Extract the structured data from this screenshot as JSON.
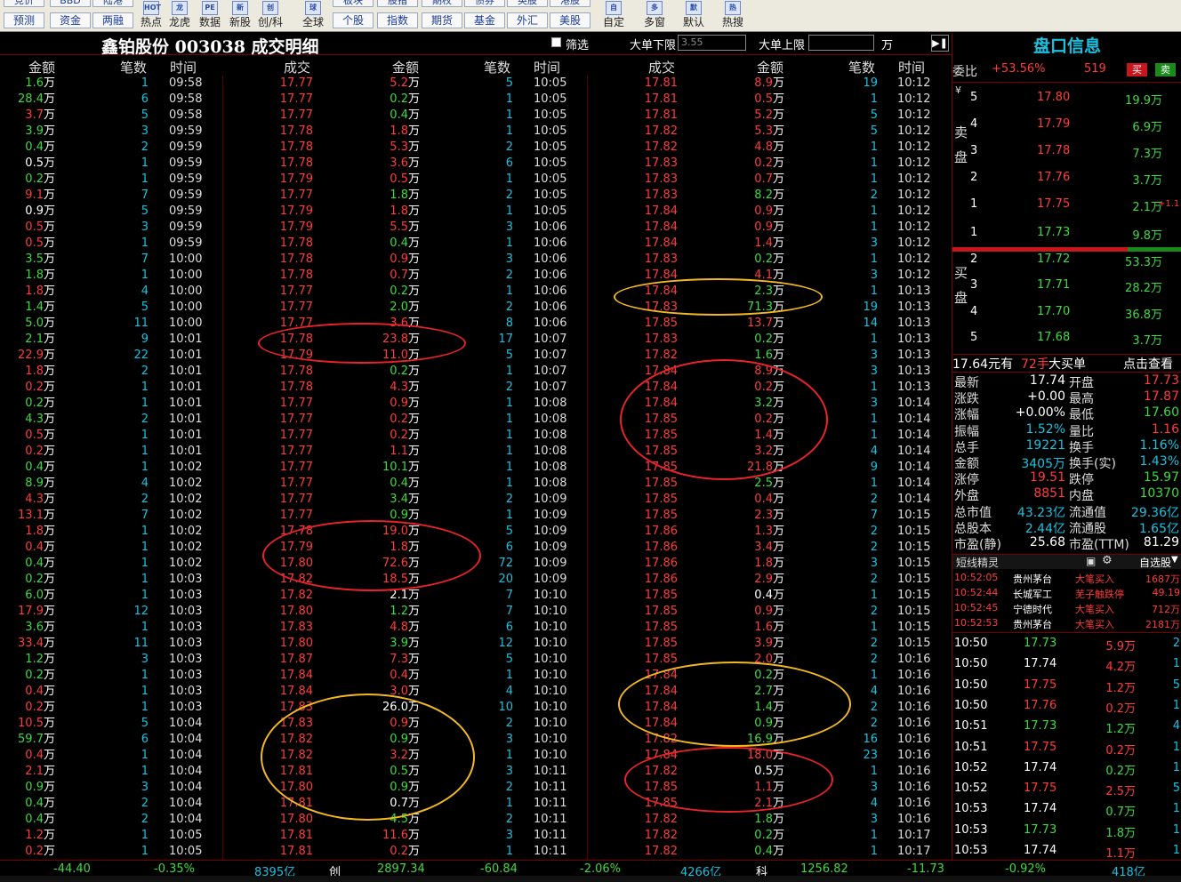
{
  "toolbar": {
    "pairs": [
      {
        "top": "竞价",
        "bottom": "预测"
      },
      {
        "top": "BBD",
        "bottom": "资金"
      },
      {
        "top": "陆港",
        "bottom": "两融"
      }
    ],
    "big": [
      {
        "icon": "HOT",
        "label": "热点"
      },
      {
        "icon": "龙",
        "label": "龙虎"
      },
      {
        "icon": "PE",
        "label": "数据"
      },
      {
        "icon": "新",
        "label": "新股"
      },
      {
        "icon": "创",
        "label": "创/科"
      },
      {
        "icon": "球",
        "label": "全球"
      }
    ],
    "pairs2": [
      {
        "top": "板块",
        "bottom": "个股"
      },
      {
        "top": "股指",
        "bottom": "指数"
      },
      {
        "top": "期权",
        "bottom": "期货"
      },
      {
        "top": "债券",
        "bottom": "基金"
      },
      {
        "top": "英股",
        "bottom": "外汇"
      },
      {
        "top": "港股",
        "bottom": "美股"
      }
    ],
    "right": [
      {
        "icon": "自",
        "label": "自定"
      },
      {
        "icon": "多",
        "label": "多窗"
      },
      {
        "icon": "默",
        "label": "默认"
      },
      {
        "icon": "热",
        "label": "热搜"
      }
    ]
  },
  "header": {
    "title": "鑫铂股份 003038 成交明细",
    "filter_label": "筛选",
    "lower_label": "大单下限",
    "lower_value": "3.55",
    "upper_label": "大单上限",
    "upper_value": "",
    "unit": "万"
  },
  "columns": {
    "g1": [
      "金额",
      "笔数",
      "时间"
    ],
    "g2": [
      "成交",
      "金额",
      "笔数",
      "时间"
    ],
    "g3": [
      "成交",
      "金额",
      "笔数",
      "时间"
    ]
  },
  "colors": {
    "red": "#ff3b3b",
    "green": "#3cdc3c",
    "cyan": "#19c1e0",
    "white": "#ffffff",
    "ellipse_red": "#e8232a",
    "ellipse_orange": "#f3b823"
  },
  "rows1": [
    [
      "1.6",
      "g",
      "1",
      "09:58"
    ],
    [
      "28.4",
      "g",
      "6",
      "09:58"
    ],
    [
      "3.7",
      "r",
      "5",
      "09:58"
    ],
    [
      "3.9",
      "g",
      "3",
      "09:59"
    ],
    [
      "0.4",
      "g",
      "2",
      "09:59"
    ],
    [
      "0.5",
      "w",
      "1",
      "09:59"
    ],
    [
      "0.2",
      "g",
      "1",
      "09:59"
    ],
    [
      "9.1",
      "r",
      "7",
      "09:59"
    ],
    [
      "0.9",
      "w",
      "5",
      "09:59"
    ],
    [
      "0.5",
      "r",
      "3",
      "09:59"
    ],
    [
      "0.5",
      "r",
      "1",
      "09:59"
    ],
    [
      "3.5",
      "g",
      "7",
      "10:00"
    ],
    [
      "1.8",
      "g",
      "1",
      "10:00"
    ],
    [
      "1.8",
      "r",
      "4",
      "10:00"
    ],
    [
      "1.4",
      "g",
      "5",
      "10:00"
    ],
    [
      "5.0",
      "g",
      "11",
      "10:00"
    ],
    [
      "2.1",
      "g",
      "9",
      "10:01"
    ],
    [
      "22.9",
      "r",
      "22",
      "10:01"
    ],
    [
      "1.8",
      "r",
      "2",
      "10:01"
    ],
    [
      "0.2",
      "r",
      "1",
      "10:01"
    ],
    [
      "0.2",
      "g",
      "1",
      "10:01"
    ],
    [
      "4.3",
      "g",
      "2",
      "10:01"
    ],
    [
      "0.5",
      "r",
      "1",
      "10:01"
    ],
    [
      "0.2",
      "r",
      "1",
      "10:01"
    ],
    [
      "0.4",
      "g",
      "1",
      "10:02"
    ],
    [
      "8.9",
      "g",
      "4",
      "10:02"
    ],
    [
      "4.3",
      "r",
      "2",
      "10:02"
    ],
    [
      "13.1",
      "r",
      "7",
      "10:02"
    ],
    [
      "1.8",
      "r",
      "1",
      "10:02"
    ],
    [
      "0.4",
      "r",
      "1",
      "10:02"
    ],
    [
      "0.4",
      "g",
      "1",
      "10:02"
    ],
    [
      "0.2",
      "g",
      "1",
      "10:03"
    ],
    [
      "6.0",
      "g",
      "1",
      "10:03"
    ],
    [
      "17.9",
      "r",
      "12",
      "10:03"
    ],
    [
      "3.6",
      "g",
      "1",
      "10:03"
    ],
    [
      "33.4",
      "r",
      "11",
      "10:03"
    ],
    [
      "1.2",
      "g",
      "3",
      "10:03"
    ],
    [
      "0.2",
      "g",
      "1",
      "10:03"
    ],
    [
      "0.4",
      "r",
      "1",
      "10:03"
    ],
    [
      "0.2",
      "r",
      "1",
      "10:03"
    ],
    [
      "10.5",
      "r",
      "5",
      "10:04"
    ],
    [
      "59.7",
      "g",
      "6",
      "10:04"
    ],
    [
      "0.4",
      "r",
      "1",
      "10:04"
    ],
    [
      "2.1",
      "r",
      "1",
      "10:04"
    ],
    [
      "0.9",
      "g",
      "3",
      "10:04"
    ],
    [
      "0.4",
      "g",
      "2",
      "10:04"
    ],
    [
      "0.4",
      "g",
      "2",
      "10:04"
    ],
    [
      "1.2",
      "r",
      "1",
      "10:05"
    ],
    [
      "0.2",
      "r",
      "1",
      "10:05"
    ]
  ],
  "rows2": [
    [
      "17.77",
      "5.2",
      "r",
      "5",
      "10:05"
    ],
    [
      "17.77",
      "0.2",
      "g",
      "1",
      "10:05"
    ],
    [
      "17.77",
      "0.4",
      "g",
      "1",
      "10:05"
    ],
    [
      "17.78",
      "1.8",
      "r",
      "1",
      "10:05"
    ],
    [
      "17.78",
      "5.3",
      "r",
      "2",
      "10:05"
    ],
    [
      "17.78",
      "3.6",
      "r",
      "6",
      "10:05"
    ],
    [
      "17.79",
      "0.5",
      "r",
      "1",
      "10:05"
    ],
    [
      "17.77",
      "1.8",
      "g",
      "2",
      "10:05"
    ],
    [
      "17.79",
      "1.8",
      "r",
      "1",
      "10:05"
    ],
    [
      "17.79",
      "5.5",
      "r",
      "3",
      "10:06"
    ],
    [
      "17.78",
      "0.4",
      "g",
      "1",
      "10:06"
    ],
    [
      "17.78",
      "0.9",
      "r",
      "3",
      "10:06"
    ],
    [
      "17.78",
      "0.7",
      "r",
      "2",
      "10:06"
    ],
    [
      "17.77",
      "0.2",
      "g",
      "1",
      "10:06"
    ],
    [
      "17.77",
      "2.0",
      "g",
      "2",
      "10:06"
    ],
    [
      "17.77",
      "3.6",
      "r",
      "8",
      "10:06"
    ],
    [
      "17.78",
      "23.8",
      "r",
      "17",
      "10:07"
    ],
    [
      "17.79",
      "11.0",
      "r",
      "5",
      "10:07"
    ],
    [
      "17.78",
      "0.2",
      "g",
      "1",
      "10:07"
    ],
    [
      "17.78",
      "4.3",
      "r",
      "2",
      "10:07"
    ],
    [
      "17.77",
      "0.9",
      "r",
      "1",
      "10:08"
    ],
    [
      "17.77",
      "0.2",
      "r",
      "1",
      "10:08"
    ],
    [
      "17.77",
      "0.2",
      "r",
      "1",
      "10:08"
    ],
    [
      "17.77",
      "1.1",
      "r",
      "1",
      "10:08"
    ],
    [
      "17.77",
      "10.1",
      "g",
      "1",
      "10:08"
    ],
    [
      "17.77",
      "0.4",
      "g",
      "1",
      "10:08"
    ],
    [
      "17.77",
      "3.4",
      "g",
      "2",
      "10:09"
    ],
    [
      "17.77",
      "0.9",
      "g",
      "1",
      "10:09"
    ],
    [
      "17.78",
      "19.0",
      "r",
      "5",
      "10:09"
    ],
    [
      "17.79",
      "1.8",
      "r",
      "6",
      "10:09"
    ],
    [
      "17.80",
      "72.6",
      "r",
      "72",
      "10:09"
    ],
    [
      "17.82",
      "18.5",
      "r",
      "20",
      "10:09"
    ],
    [
      "17.82",
      "2.1",
      "w",
      "7",
      "10:10"
    ],
    [
      "17.80",
      "1.2",
      "g",
      "7",
      "10:10"
    ],
    [
      "17.83",
      "4.8",
      "r",
      "6",
      "10:10"
    ],
    [
      "17.80",
      "3.9",
      "g",
      "12",
      "10:10"
    ],
    [
      "17.87",
      "7.3",
      "r",
      "5",
      "10:10"
    ],
    [
      "17.84",
      "0.4",
      "r",
      "1",
      "10:10"
    ],
    [
      "17.84",
      "3.0",
      "r",
      "4",
      "10:10"
    ],
    [
      "17.83",
      "26.0",
      "w",
      "10",
      "10:10"
    ],
    [
      "17.83",
      "0.9",
      "r",
      "2",
      "10:10"
    ],
    [
      "17.82",
      "0.9",
      "g",
      "3",
      "10:10"
    ],
    [
      "17.82",
      "3.2",
      "r",
      "1",
      "10:10"
    ],
    [
      "17.81",
      "0.5",
      "g",
      "3",
      "10:11"
    ],
    [
      "17.80",
      "0.9",
      "g",
      "2",
      "10:11"
    ],
    [
      "17.81",
      "0.7",
      "w",
      "1",
      "10:11"
    ],
    [
      "17.80",
      "4.5",
      "g",
      "2",
      "10:11"
    ],
    [
      "17.81",
      "11.6",
      "r",
      "3",
      "10:11"
    ],
    [
      "17.81",
      "0.2",
      "r",
      "1",
      "10:11"
    ]
  ],
  "rows3": [
    [
      "17.81",
      "8.9",
      "r",
      "19",
      "10:12"
    ],
    [
      "17.81",
      "0.5",
      "r",
      "1",
      "10:12"
    ],
    [
      "17.81",
      "5.2",
      "r",
      "5",
      "10:12"
    ],
    [
      "17.82",
      "5.3",
      "r",
      "5",
      "10:12"
    ],
    [
      "17.82",
      "4.8",
      "r",
      "1",
      "10:12"
    ],
    [
      "17.83",
      "0.2",
      "r",
      "1",
      "10:12"
    ],
    [
      "17.83",
      "0.7",
      "r",
      "1",
      "10:12"
    ],
    [
      "17.83",
      "8.2",
      "g",
      "2",
      "10:12"
    ],
    [
      "17.84",
      "0.9",
      "r",
      "1",
      "10:12"
    ],
    [
      "17.84",
      "0.9",
      "r",
      "1",
      "10:12"
    ],
    [
      "17.84",
      "1.4",
      "r",
      "3",
      "10:12"
    ],
    [
      "17.83",
      "0.2",
      "g",
      "1",
      "10:12"
    ],
    [
      "17.84",
      "4.1",
      "r",
      "3",
      "10:12"
    ],
    [
      "17.84",
      "2.3",
      "g",
      "1",
      "10:13"
    ],
    [
      "17.83",
      "71.3",
      "g",
      "19",
      "10:13"
    ],
    [
      "17.85",
      "13.7",
      "r",
      "14",
      "10:13"
    ],
    [
      "17.83",
      "0.2",
      "g",
      "1",
      "10:13"
    ],
    [
      "17.82",
      "1.6",
      "g",
      "3",
      "10:13"
    ],
    [
      "17.84",
      "8.9",
      "r",
      "3",
      "10:13"
    ],
    [
      "17.84",
      "0.2",
      "r",
      "1",
      "10:13"
    ],
    [
      "17.84",
      "3.2",
      "g",
      "3",
      "10:14"
    ],
    [
      "17.85",
      "0.2",
      "r",
      "1",
      "10:14"
    ],
    [
      "17.85",
      "1.4",
      "r",
      "1",
      "10:14"
    ],
    [
      "17.85",
      "3.2",
      "r",
      "4",
      "10:14"
    ],
    [
      "17.85",
      "21.8",
      "r",
      "9",
      "10:14"
    ],
    [
      "17.85",
      "2.5",
      "g",
      "1",
      "10:14"
    ],
    [
      "17.85",
      "0.4",
      "r",
      "2",
      "10:14"
    ],
    [
      "17.85",
      "2.3",
      "r",
      "7",
      "10:15"
    ],
    [
      "17.86",
      "1.3",
      "r",
      "2",
      "10:15"
    ],
    [
      "17.86",
      "3.4",
      "r",
      "2",
      "10:15"
    ],
    [
      "17.86",
      "1.8",
      "r",
      "3",
      "10:15"
    ],
    [
      "17.86",
      "2.9",
      "r",
      "2",
      "10:15"
    ],
    [
      "17.85",
      "0.4",
      "w",
      "1",
      "10:15"
    ],
    [
      "17.85",
      "0.9",
      "r",
      "2",
      "10:15"
    ],
    [
      "17.85",
      "1.6",
      "r",
      "1",
      "10:15"
    ],
    [
      "17.85",
      "3.9",
      "r",
      "2",
      "10:15"
    ],
    [
      "17.85",
      "2.0",
      "r",
      "2",
      "10:16"
    ],
    [
      "17.84",
      "0.2",
      "g",
      "1",
      "10:16"
    ],
    [
      "17.84",
      "2.7",
      "g",
      "4",
      "10:16"
    ],
    [
      "17.84",
      "1.4",
      "g",
      "2",
      "10:16"
    ],
    [
      "17.84",
      "0.9",
      "g",
      "2",
      "10:16"
    ],
    [
      "17.82",
      "16.9",
      "g",
      "16",
      "10:16"
    ],
    [
      "17.84",
      "18.0",
      "r",
      "23",
      "10:16"
    ],
    [
      "17.82",
      "0.5",
      "w",
      "1",
      "10:16"
    ],
    [
      "17.85",
      "1.1",
      "r",
      "3",
      "10:16"
    ],
    [
      "17.85",
      "2.1",
      "r",
      "4",
      "10:16"
    ],
    [
      "17.82",
      "1.8",
      "g",
      "3",
      "10:16"
    ],
    [
      "17.82",
      "0.2",
      "g",
      "1",
      "10:17"
    ],
    [
      "17.82",
      "0.4",
      "g",
      "1",
      "10:17"
    ]
  ],
  "footer": {
    "items": [
      {
        "text": "-44.40",
        "color": "g"
      },
      {
        "text": "-0.35%",
        "color": "g"
      },
      {
        "text": "8395亿",
        "color": "c"
      },
      {
        "text": "创",
        "color": "w"
      },
      {
        "text": "2897.34",
        "color": "g"
      },
      {
        "text": "-60.84",
        "color": "g"
      },
      {
        "text": "-2.06%",
        "color": "g"
      },
      {
        "text": "4266亿",
        "color": "c"
      },
      {
        "text": "科",
        "color": "w"
      },
      {
        "text": "1256.82",
        "color": "g"
      },
      {
        "text": "-11.73",
        "color": "g"
      },
      {
        "text": "-0.92%",
        "color": "g"
      },
      {
        "text": "418亿",
        "color": "c"
      }
    ]
  },
  "panel": {
    "title": "盘口信息",
    "weibi_label": "委比",
    "weibi_value": "+53.56%",
    "weibi_diff": "519",
    "buy_btn": "买",
    "sell_btn": "卖",
    "sell_label": "卖盘",
    "buy_label": "买盘",
    "yen": "¥",
    "asks": [
      {
        "level": "5",
        "price": "17.80",
        "vol": "19.9万"
      },
      {
        "level": "4",
        "price": "17.79",
        "vol": "6.9万"
      },
      {
        "level": "3",
        "price": "17.78",
        "vol": "7.3万"
      },
      {
        "level": "2",
        "price": "17.76",
        "vol": "3.7万"
      },
      {
        "level": "1",
        "price": "17.75",
        "vol": "2.1万",
        "extra": "+1.1"
      }
    ],
    "bids": [
      {
        "level": "1",
        "price": "17.73",
        "vol": "9.8万"
      },
      {
        "level": "2",
        "price": "17.72",
        "vol": "53.3万"
      },
      {
        "level": "3",
        "price": "17.71",
        "vol": "28.2万"
      },
      {
        "level": "4",
        "price": "17.70",
        "vol": "36.8万"
      },
      {
        "level": "5",
        "price": "17.68",
        "vol": "3.7万"
      }
    ],
    "bigorder": {
      "price": "17.64元有",
      "qty": "72手",
      "label": "大买单",
      "link": "点击查看"
    },
    "stats": [
      [
        "最新",
        "17.74",
        "w",
        "开盘",
        "17.73",
        "r"
      ],
      [
        "涨跌",
        "+0.00",
        "w",
        "最高",
        "17.87",
        "r"
      ],
      [
        "涨幅",
        "+0.00%",
        "w",
        "最低",
        "17.60",
        "g"
      ],
      [
        "振幅",
        "1.52%",
        "c",
        "量比",
        "1.16",
        "r"
      ],
      [
        "总手",
        "19221",
        "c",
        "换手",
        "1.16%",
        "c"
      ],
      [
        "金额",
        "3405万",
        "c",
        "换手(实)",
        "1.43%",
        "c"
      ],
      [
        "涨停",
        "19.51",
        "r",
        "跌停",
        "15.97",
        "g"
      ],
      [
        "外盘",
        "8851",
        "r",
        "内盘",
        "10370",
        "g"
      ],
      [
        "总市值",
        "43.23亿",
        "c",
        "流通值",
        "29.36亿",
        "c"
      ],
      [
        "总股本",
        "2.44亿",
        "c",
        "流通股",
        "1.65亿",
        "c"
      ],
      [
        "市盈(静)",
        "25.68",
        "w",
        "市盈(TTM)",
        "81.29",
        "w"
      ]
    ],
    "sprite_title": "短线精灵",
    "sprite_select": "自选股",
    "sprite": [
      {
        "time": "10:52:05",
        "name": "贵州茅台",
        "event": "大笔买入",
        "val": "1687万"
      },
      {
        "time": "10:52:44",
        "name": "长城军工",
        "event": "芜子触跌停",
        "val": "49.19"
      },
      {
        "time": "10:52:45",
        "name": "宁德时代",
        "event": "大笔买入",
        "val": "712万"
      },
      {
        "time": "10:52:53",
        "name": "贵州茅台",
        "event": "大笔买入",
        "val": "2181万"
      }
    ],
    "ticks": [
      {
        "time": "10:50",
        "price": "17.73",
        "pc": "g",
        "amt": "5.9万",
        "ac": "r",
        "n": "2"
      },
      {
        "time": "10:50",
        "price": "17.74",
        "pc": "w",
        "amt": "4.2万",
        "ac": "r",
        "n": "1"
      },
      {
        "time": "10:50",
        "price": "17.75",
        "pc": "r",
        "amt": "1.2万",
        "ac": "r",
        "n": "5"
      },
      {
        "time": "10:50",
        "price": "17.76",
        "pc": "r",
        "amt": "0.2万",
        "ac": "r",
        "n": "1"
      },
      {
        "time": "10:51",
        "price": "17.73",
        "pc": "g",
        "amt": "1.2万",
        "ac": "g",
        "n": "4"
      },
      {
        "time": "10:51",
        "price": "17.75",
        "pc": "r",
        "amt": "0.2万",
        "ac": "r",
        "n": "1"
      },
      {
        "time": "10:52",
        "price": "17.74",
        "pc": "w",
        "amt": "0.2万",
        "ac": "g",
        "n": "1"
      },
      {
        "time": "10:52",
        "price": "17.75",
        "pc": "r",
        "amt": "2.5万",
        "ac": "r",
        "n": "5"
      },
      {
        "time": "10:53",
        "price": "17.74",
        "pc": "w",
        "amt": "0.7万",
        "ac": "g",
        "n": "1"
      },
      {
        "time": "10:53",
        "price": "17.73",
        "pc": "g",
        "amt": "1.8万",
        "ac": "g",
        "n": "1"
      },
      {
        "time": "10:53",
        "price": "17.74",
        "pc": "w",
        "amt": "1.1万",
        "ac": "r",
        "n": "1"
      }
    ]
  },
  "unit_wan": "万"
}
